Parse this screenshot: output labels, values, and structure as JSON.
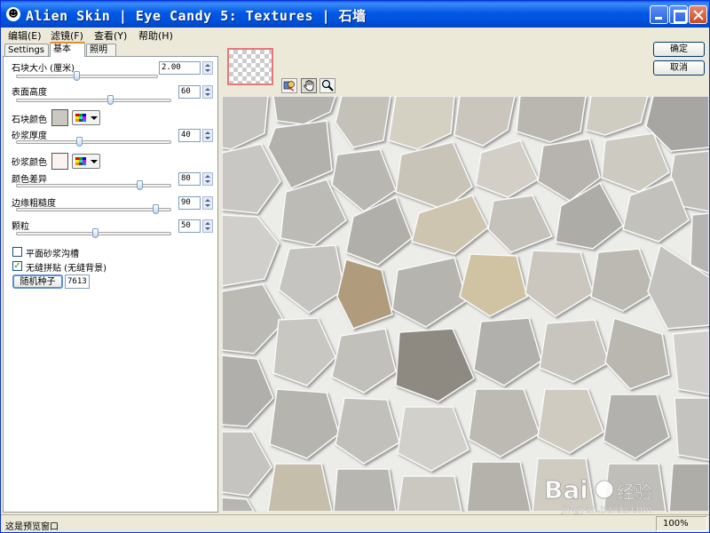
{
  "window": {
    "title": "Alien Skin | Eye Candy 5: Textures | 石墙"
  },
  "menu": {
    "items": [
      {
        "label": "编辑(E)"
      },
      {
        "label": "滤镜(F)"
      },
      {
        "label": "查看(Y)"
      },
      {
        "label": "帮助(H)"
      }
    ]
  },
  "tabs": {
    "settings": "Settings",
    "basic": "基本",
    "lighting": "照明"
  },
  "controls": {
    "stone_size": {
      "label": "石块大小 (厘米)",
      "value": "2.00",
      "level": 0.42
    },
    "surface_height": {
      "label": "表面高度",
      "value": "60",
      "level": 0.6
    },
    "stone_color": {
      "label": "石块颜色",
      "color": "#cbc8c2"
    },
    "grout_thickness": {
      "label": "砂浆厚度",
      "value": "40",
      "level": 0.4
    },
    "grout_color": {
      "label": "砂浆颜色",
      "color": "#fbf2f2"
    },
    "color_variation": {
      "label": "颜色差异",
      "value": "80",
      "level": 0.8
    },
    "edge_roughness": {
      "label": "边缘粗糙度",
      "value": "90",
      "level": 0.9
    },
    "grain": {
      "label": "颗粒",
      "value": "50",
      "level": 0.5
    },
    "flat_grout": {
      "label": "平面砂浆沟槽",
      "checked": false
    },
    "seamless": {
      "label": "无缝拼贴 (无缝背景)",
      "checked": true
    },
    "random_seed_button": "随机种子",
    "seed_value": "7613"
  },
  "buttons": {
    "ok": "确定",
    "cancel": "取消"
  },
  "status": {
    "text": "这是预览窗口",
    "zoom": "100%"
  },
  "watermark": {
    "brand": "Baidu经验",
    "url": "jingyan.baidu.com"
  },
  "colors": {
    "titlebar": "#0058e6",
    "panel": "#ece9d8",
    "grout": "#f4f4f2"
  }
}
